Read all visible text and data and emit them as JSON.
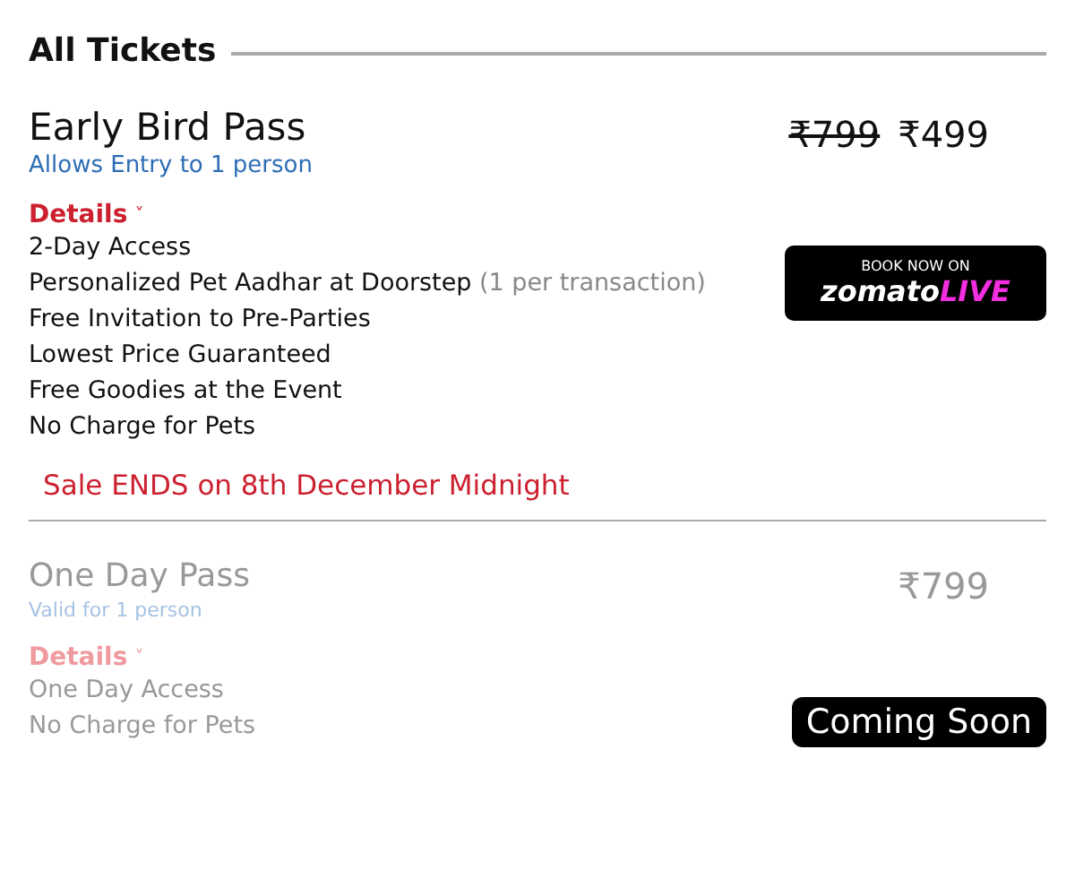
{
  "heading": "All Tickets",
  "tickets": [
    {
      "name": "Early Bird Pass",
      "subtitle": "Allows Entry to 1 person",
      "original_price": "₹799",
      "price": "₹499",
      "details_label": "Details",
      "details_icon": "˅",
      "disabled": false,
      "features": [
        {
          "text": "2-Day Access"
        },
        {
          "text": "Personalized Pet Aadhar at Doorstep",
          "note": "(1 per transaction)"
        },
        {
          "text": "Free Invitation to Pre-Parties"
        },
        {
          "text": "Lowest Price Guaranteed"
        },
        {
          "text": "Free Goodies at the Event"
        },
        {
          "text": "No Charge for Pets"
        }
      ],
      "action": {
        "kind": "partner",
        "caption": "BOOK NOW ON",
        "brand": "zomato",
        "brand_accent": "LIVE"
      },
      "notice": "Sale ENDS on 8th December Midnight"
    },
    {
      "name": "One Day Pass",
      "subtitle": "Valid for 1 person",
      "price": "₹799",
      "details_label": "Details",
      "details_icon": "˅",
      "disabled": true,
      "features": [
        {
          "text": "One Day Access"
        },
        {
          "text": "No Charge for Pets"
        }
      ],
      "action": {
        "kind": "label",
        "text": "Coming Soon"
      }
    }
  ]
}
